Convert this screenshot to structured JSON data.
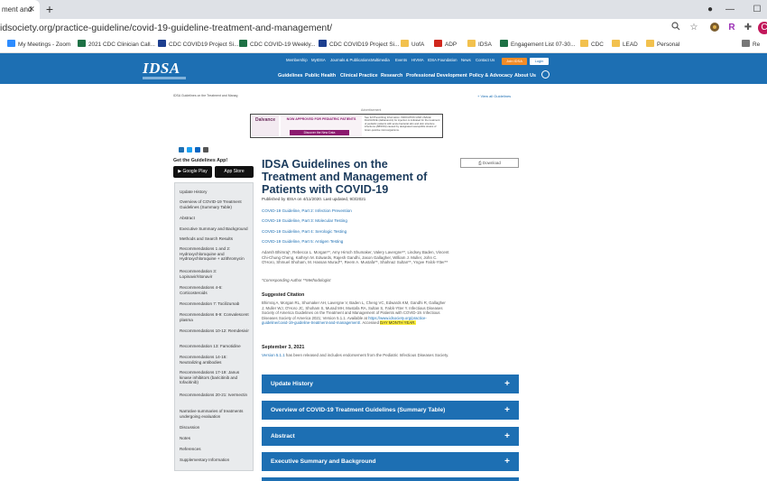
{
  "browser": {
    "tab_title": "ment and",
    "url": "idsociety.org/practice-guideline/covid-19-guideline-treatment-and-management/",
    "profile_letter": "R",
    "avatar_letter": "C",
    "bookmarks": [
      {
        "label": "My Meetings - Zoom",
        "color": "#2d8cff"
      },
      {
        "label": "2021 CDC Clinician Call...",
        "color": "#1e7145"
      },
      {
        "label": "CDC COVID19 Project Si...",
        "color": "#1d3f8f"
      },
      {
        "label": "CDC COVID-19 Weekly...",
        "color": "#1e7145"
      },
      {
        "label": "CDC COVID19 Project Si...",
        "color": "#1d3f8f"
      },
      {
        "label": "UofA",
        "color": "#f2c14e"
      },
      {
        "label": "ADP",
        "color": "#d0271d"
      },
      {
        "label": "IDSA",
        "color": "#f2c14e"
      },
      {
        "label": "Engagement List 07-30...",
        "color": "#1e7145"
      },
      {
        "label": "CDC",
        "color": "#f2c14e"
      },
      {
        "label": "LEAD",
        "color": "#f2c14e"
      },
      {
        "label": "Personal",
        "color": "#f2c14e"
      }
    ],
    "bookmarks_more": "Re"
  },
  "site": {
    "logo": "IDSA",
    "utility_nav": [
      "Membership",
      "MyIDSA",
      "Journals & Publications",
      "Multimedia",
      "Events",
      "HIVMA",
      "IDSA Foundation",
      "News",
      "Contact Us"
    ],
    "join_label": "Join IDSA",
    "login_label": "Login",
    "main_nav": [
      "Guidelines",
      "Public Health",
      "Clinical Practice",
      "Research",
      "Professional Development",
      "Policy & Advocacy",
      "About Us"
    ]
  },
  "page": {
    "breadcrumb": "IDSA Guidelines on the Treatment and Manag",
    "view_all": "+ View all Guidelines",
    "ad_label": "Advertisement",
    "ad": {
      "brand": "Dalvance",
      "headline": "NOW APPROVED FOR PEDIATRIC PATIENTS",
      "cta": "Discover the New Data",
      "fine_print": "See full Prescribing Information. INDICATION AND USAGE: DALVANCE (dalbavancin) for injection is indicated for the treatment of pediatric patients with acute bacterial skin and skin structure infections (ABSSSI) caused by designated susceptible strains of Gram-positive microorganisms."
    },
    "app_label": "Get the Guidelines App!",
    "google_play": "Google Play",
    "app_store": "App Store",
    "download_label": "Download",
    "side_nav": [
      "Update History",
      "Overview of COVID-19 Treatment Guidelines (Summary Table)",
      "Abstract",
      "Executive Summary and Background",
      "Methods and Search Results",
      "Recommendations 1 and 2: Hydroxychloroquine and Hydroxychloroquine + azithromycin",
      "Recommendation 3: Lopinavir/ritonavir",
      "Recommendations 4-6: Corticosteroids",
      "Recommendation 7: Tocilizumab",
      "Recommendations 8-9: Convalescent plasma",
      "Recommendations 10-12: Remdesivir",
      "Recommendation 13: Famotidine",
      "Recommendations 14-16: Neutralizing antibodies",
      "Recommendations 17-19: Janus kinase inhibitors (baricitinib and tofacitinib)",
      "Recommendations 20-21: Ivermectin",
      "Narrative summaries of treatments undergoing evaluation",
      "Discussion",
      "Notes",
      "References",
      "Supplementary Information"
    ],
    "title": "IDSA Guidelines on the Treatment and Management of Patients with COVID-19",
    "published": "Published by IDSA on 4/11/2020. Last updated, 9/3/2021",
    "related_links": [
      "COVID-19 Guideline, Part 2: Infection Prevention",
      "COVID-19 Guideline, Part 3: Molecular Testing",
      "COVID-19 Guideline, Part 4: Serologic Testing",
      "COVID-19 Guideline, Part 5: Antigen Testing"
    ],
    "authors": "Adarsh Bhimraj*, Rebecca L. Morgan**, Amy Hirsch Shumaker, Valery Lavergne**, Lindsey Baden, Vincent Chi-Chung Cheng, Kathryn M. Edwards, Rajesh Gandhi, Jason Gallagher, William J. Muller, John C. O'Horo, Shmuel Shoham, M. Hassan Murad**, Reem A. Mustafa**, Shahnaz Sultan**, Yngve Falck-Ytter**",
    "corresponding": "*Corresponding Author **Methodologist",
    "citation_heading": "Suggested Citation",
    "citation_text": "Bhimraj A, Morgan RL, Shumaker AH, Lavergne V, Baden L, Cheng VC, Edwards KM, Gandhi R, Gallagher J, Muller WJ, O'Horo JC, Shoham S, Murad MH, Mustafa RA, Sultan S, Falck-Ytter Y. Infectious Diseases Society of America Guidelines on the Treatment and Management of Patients with COVID-19. Infectious Diseases Society of America 2021; Version 5.1.1. Available at",
    "citation_url": "https://www.idsociety.org/practice-guideline/covid-19-guideline-treatment-and-management/.",
    "citation_accessed": "Accessed",
    "citation_date_placeholder": "DAY MONTH YEAR.",
    "update_date": "September 3, 2021",
    "update_version": "Version 5.1.1",
    "update_text": "has been released and includes endorsement from the Pediatric Infectious Diseases Society.",
    "accordion": [
      "Update History",
      "Overview of COVID-19 Treatment Guidelines (Summary Table)",
      "Abstract",
      "Executive Summary and Background"
    ]
  }
}
